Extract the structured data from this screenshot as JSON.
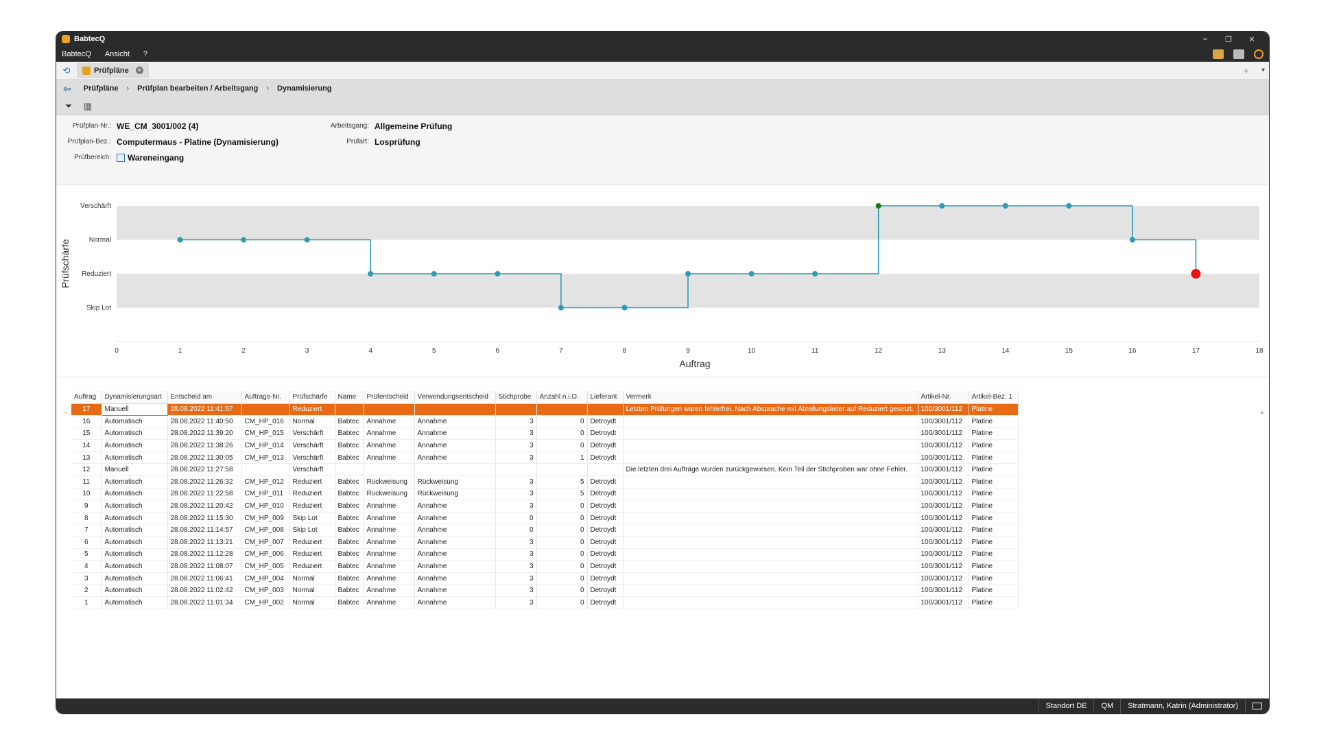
{
  "app": {
    "title": "BabtecQ",
    "menu": [
      "BabtecQ",
      "Ansicht",
      "?"
    ],
    "window_controls": {
      "minimize": "–",
      "restore": "❐",
      "close": "✕"
    }
  },
  "tabs": {
    "active_label": "Prüfpläne"
  },
  "breadcrumb": {
    "items": [
      "Prüfpläne",
      "Prüfplan bearbeiten / Arbeitsgang",
      "Dynamisierung"
    ],
    "separator": "›"
  },
  "info": {
    "pruefplan_nr_label": "Prüfplan-Nr.:",
    "pruefplan_nr": "WE_CM_3001/002 (4)",
    "pruefplan_bez_label": "Prüfplan-Bez.:",
    "pruefplan_bez": "Computermaus - Platine (Dynamisierung)",
    "pruefbereich_label": "Prüfbereich:",
    "pruefbereich": "Wareneingang",
    "arbeitsgang_label": "Arbeitsgang:",
    "arbeitsgang": "Allgemeine Prüfung",
    "pruefart_label": "Prüfart:",
    "pruefart": "Losprüfung"
  },
  "chart_data": {
    "type": "line",
    "step": true,
    "xlabel": "Auftrag",
    "ylabel": "Prüfschärfe",
    "xlim": [
      0,
      18
    ],
    "x_ticks": [
      0,
      1,
      2,
      3,
      4,
      5,
      6,
      7,
      8,
      9,
      10,
      11,
      12,
      13,
      14,
      15,
      16,
      17,
      18
    ],
    "y_categories": [
      "Skip Lot",
      "Reduziert",
      "Normal",
      "Verschärft"
    ],
    "x": [
      1,
      2,
      3,
      4,
      5,
      6,
      7,
      8,
      9,
      10,
      11,
      12,
      13,
      14,
      15,
      16,
      17
    ],
    "y": [
      "Normal",
      "Normal",
      "Normal",
      "Reduziert",
      "Reduziert",
      "Reduziert",
      "Skip Lot",
      "Skip Lot",
      "Reduziert",
      "Reduziert",
      "Reduziert",
      "Verschärft",
      "Verschärft",
      "Verschärft",
      "Verschärft",
      "Normal",
      "Reduziert"
    ],
    "colors": {
      "line": "#2d9bb5",
      "manual_point": "#1a7a1a",
      "current_point": "#ee1111",
      "band": "#e3e3e3"
    }
  },
  "table": {
    "columns": [
      "Auftrag",
      "Dynamisierungsart",
      "Entscheid am",
      "Auftrags-Nr.",
      "Prüfschärfe",
      "Name",
      "Prüfentscheid",
      "Verwendungsentscheid",
      "Stichprobe",
      "Anzahl n.i.O.",
      "Lieferant",
      "Vermerk",
      "Artikel-Nr.",
      "Artikel-Bez. 1"
    ],
    "rows": [
      [
        "17",
        "Manuell",
        "28.08.2022 11:41:57",
        "",
        "Reduziert",
        "",
        "",
        "",
        "",
        "",
        "",
        "Letzten Prüfungen waren fehlerfrei. Nach Absprache mit Abteilungsleiter auf Reduziert gesetzt.",
        "100/3001/112",
        "Platine"
      ],
      [
        "16",
        "Automatisch",
        "28.08.2022 11:40:50",
        "CM_HP_016",
        "Normal",
        "Babtec",
        "Annahme",
        "Annahme",
        "3",
        "0",
        "Detroydt",
        "",
        "100/3001/112",
        "Platine"
      ],
      [
        "15",
        "Automatisch",
        "28.08.2022 11:39:20",
        "CM_HP_015",
        "Verschärft",
        "Babtec",
        "Annahme",
        "Annahme",
        "3",
        "0",
        "Detroydt",
        "",
        "100/3001/112",
        "Platine"
      ],
      [
        "14",
        "Automatisch",
        "28.08.2022 11:38:26",
        "CM_HP_014",
        "Verschärft",
        "Babtec",
        "Annahme",
        "Annahme",
        "3",
        "0",
        "Detroydt",
        "",
        "100/3001/112",
        "Platine"
      ],
      [
        "13",
        "Automatisch",
        "28.08.2022 11:30:05",
        "CM_HP_013",
        "Verschärft",
        "Babtec",
        "Annahme",
        "Annahme",
        "3",
        "1",
        "Detroydt",
        "",
        "100/3001/112",
        "Platine"
      ],
      [
        "12",
        "Manuell",
        "28.08.2022 11:27:58",
        "",
        "Verschärft",
        "",
        "",
        "",
        "",
        "",
        "",
        "Die letzten drei Aufträge wurden zurückgewiesen. Kein Teil der Stichproben war ohne Fehler.",
        "100/3001/112",
        "Platine"
      ],
      [
        "11",
        "Automatisch",
        "28.08.2022 11:26:32",
        "CM_HP_012",
        "Reduziert",
        "Babtec",
        "Rückweisung",
        "Rückweisung",
        "3",
        "5",
        "Detroydt",
        "",
        "100/3001/112",
        "Platine"
      ],
      [
        "10",
        "Automatisch",
        "28.08.2022 11:22:58",
        "CM_HP_011",
        "Reduziert",
        "Babtec",
        "Rückweisung",
        "Rückweisung",
        "3",
        "5",
        "Detroydt",
        "",
        "100/3001/112",
        "Platine"
      ],
      [
        "9",
        "Automatisch",
        "28.08.2022 11:20:42",
        "CM_HP_010",
        "Reduziert",
        "Babtec",
        "Annahme",
        "Annahme",
        "3",
        "0",
        "Detroydt",
        "",
        "100/3001/112",
        "Platine"
      ],
      [
        "8",
        "Automatisch",
        "28.08.2022 11:15:30",
        "CM_HP_009",
        "Skip Lot",
        "Babtec",
        "Annahme",
        "Annahme",
        "0",
        "0",
        "Detroydt",
        "",
        "100/3001/112",
        "Platine"
      ],
      [
        "7",
        "Automatisch",
        "28.08.2022 11:14:57",
        "CM_HP_008",
        "Skip Lot",
        "Babtec",
        "Annahme",
        "Annahme",
        "0",
        "0",
        "Detroydt",
        "",
        "100/3001/112",
        "Platine"
      ],
      [
        "6",
        "Automatisch",
        "28.08.2022 11:13:21",
        "CM_HP_007",
        "Reduziert",
        "Babtec",
        "Annahme",
        "Annahme",
        "3",
        "0",
        "Detroydt",
        "",
        "100/3001/112",
        "Platine"
      ],
      [
        "5",
        "Automatisch",
        "28.08.2022 11:12:28",
        "CM_HP_006",
        "Reduziert",
        "Babtec",
        "Annahme",
        "Annahme",
        "3",
        "0",
        "Detroydt",
        "",
        "100/3001/112",
        "Platine"
      ],
      [
        "4",
        "Automatisch",
        "28.08.2022 11:08:07",
        "CM_HP_005",
        "Reduziert",
        "Babtec",
        "Annahme",
        "Annahme",
        "3",
        "0",
        "Detroydt",
        "",
        "100/3001/112",
        "Platine"
      ],
      [
        "3",
        "Automatisch",
        "28.08.2022 11:06:41",
        "CM_HP_004",
        "Normal",
        "Babtec",
        "Annahme",
        "Annahme",
        "3",
        "0",
        "Detroydt",
        "",
        "100/3001/112",
        "Platine"
      ],
      [
        "2",
        "Automatisch",
        "28.08.2022 11:02:42",
        "CM_HP_003",
        "Normal",
        "Babtec",
        "Annahme",
        "Annahme",
        "3",
        "0",
        "Detroydt",
        "",
        "100/3001/112",
        "Platine"
      ],
      [
        "1",
        "Automatisch",
        "28.08.2022 11:01:34",
        "CM_HP_002",
        "Normal",
        "Babtec",
        "Annahme",
        "Annahme",
        "3",
        "0",
        "Detroydt",
        "",
        "100/3001/112",
        "Platine"
      ]
    ]
  },
  "status": {
    "location": "Standort DE",
    "module": "QM",
    "user": "Stratmann, Katrin (Administrator)"
  },
  "icons": {
    "home": "refresh-icon",
    "back": "arrow-left-icon",
    "filter": "filter-icon",
    "chart": "chart-settings-icon",
    "add": "plus-icon",
    "mail": "mail-icon"
  }
}
